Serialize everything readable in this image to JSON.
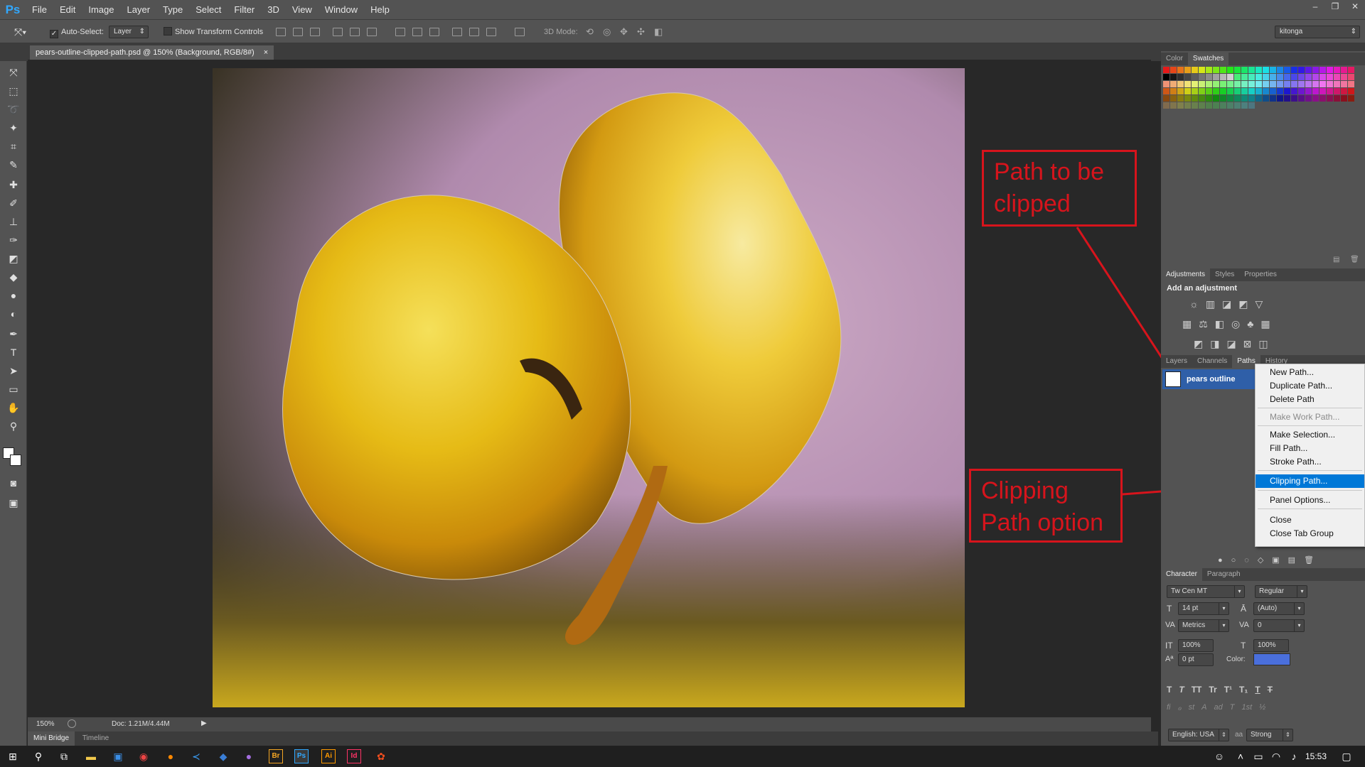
{
  "app": {
    "logo": "Ps"
  },
  "menu": [
    "File",
    "Edit",
    "Image",
    "Layer",
    "Type",
    "Select",
    "Filter",
    "3D",
    "View",
    "Window",
    "Help"
  ],
  "window_controls": [
    "–",
    "❐",
    "✕"
  ],
  "options": {
    "auto_select_label": "Auto-Select:",
    "auto_select_checked": "✓",
    "auto_select_value": "Layer",
    "show_transform_label": "Show Transform Controls",
    "mode_3d_label": "3D Mode:",
    "workspace": "kitonga"
  },
  "document": {
    "tab_title": "pears-outline-clipped-path.psd @ 150% (Background, RGB/8#)",
    "tab_close": "×",
    "zoom": "150%",
    "doc_size": "Doc: 1.21M/4.44M"
  },
  "bottom_tabs": [
    "Mini Bridge",
    "Timeline"
  ],
  "panels": {
    "color_tabs": [
      "Color",
      "Swatches"
    ],
    "adjust_tabs": [
      "Adjustments",
      "Styles",
      "Properties"
    ],
    "adjust_title": "Add an adjustment",
    "layer_tabs": [
      "Layers",
      "Channels",
      "Paths",
      "History"
    ],
    "path_item": "pears outline",
    "char_tabs": [
      "Character",
      "Paragraph"
    ],
    "font_family": "Tw Cen MT",
    "font_style": "Regular",
    "font_size": "14 pt",
    "leading": "(Auto)",
    "kerning": "Metrics",
    "tracking": "0",
    "vscale": "100%",
    "hscale": "100%",
    "baseline": "0 pt",
    "color_label": "Color:",
    "type_buttons": [
      "T",
      "T",
      "TT",
      "Tr",
      "T¹",
      "T₁",
      "T",
      "T"
    ],
    "ot_buttons": [
      "fi",
      "ℴ",
      "st",
      "A",
      "ad",
      "T",
      "1st",
      "½"
    ],
    "language": "English: USA",
    "aa_label": "aa",
    "antialias": "Strong"
  },
  "context_menu": {
    "items": [
      {
        "label": "New Path...",
        "state": "normal"
      },
      {
        "label": "Duplicate Path...",
        "state": "normal"
      },
      {
        "label": "Delete Path",
        "state": "normal"
      },
      {
        "label": "Make Work Path...",
        "state": "disabled"
      },
      {
        "label": "Make Selection...",
        "state": "normal"
      },
      {
        "label": "Fill Path...",
        "state": "normal"
      },
      {
        "label": "Stroke Path...",
        "state": "normal"
      },
      {
        "label": "Clipping Path...",
        "state": "highlighted"
      },
      {
        "label": "Panel Options...",
        "state": "normal"
      },
      {
        "label": "Close",
        "state": "normal"
      },
      {
        "label": "Close Tab Group",
        "state": "normal"
      }
    ]
  },
  "annotations": {
    "path_callout": "Path to be clipped",
    "clip_callout": "Clipping Path option"
  },
  "colors": {
    "accent": "#0078d7",
    "annotation": "#d7141c",
    "text_color_swatch": "#4a6fdc"
  },
  "taskbar": {
    "clock": "15:53",
    "apps": [
      "windows-icon",
      "search-icon",
      "task-view-icon",
      "file-explorer-icon",
      "store-icon",
      "chrome-icon",
      "firefox-icon",
      "vscode-icon",
      "sourcetree-icon",
      "tor-icon",
      "bridge-icon",
      "photoshop-icon",
      "illustrator-icon",
      "indesign-icon",
      "figma-icon"
    ]
  }
}
